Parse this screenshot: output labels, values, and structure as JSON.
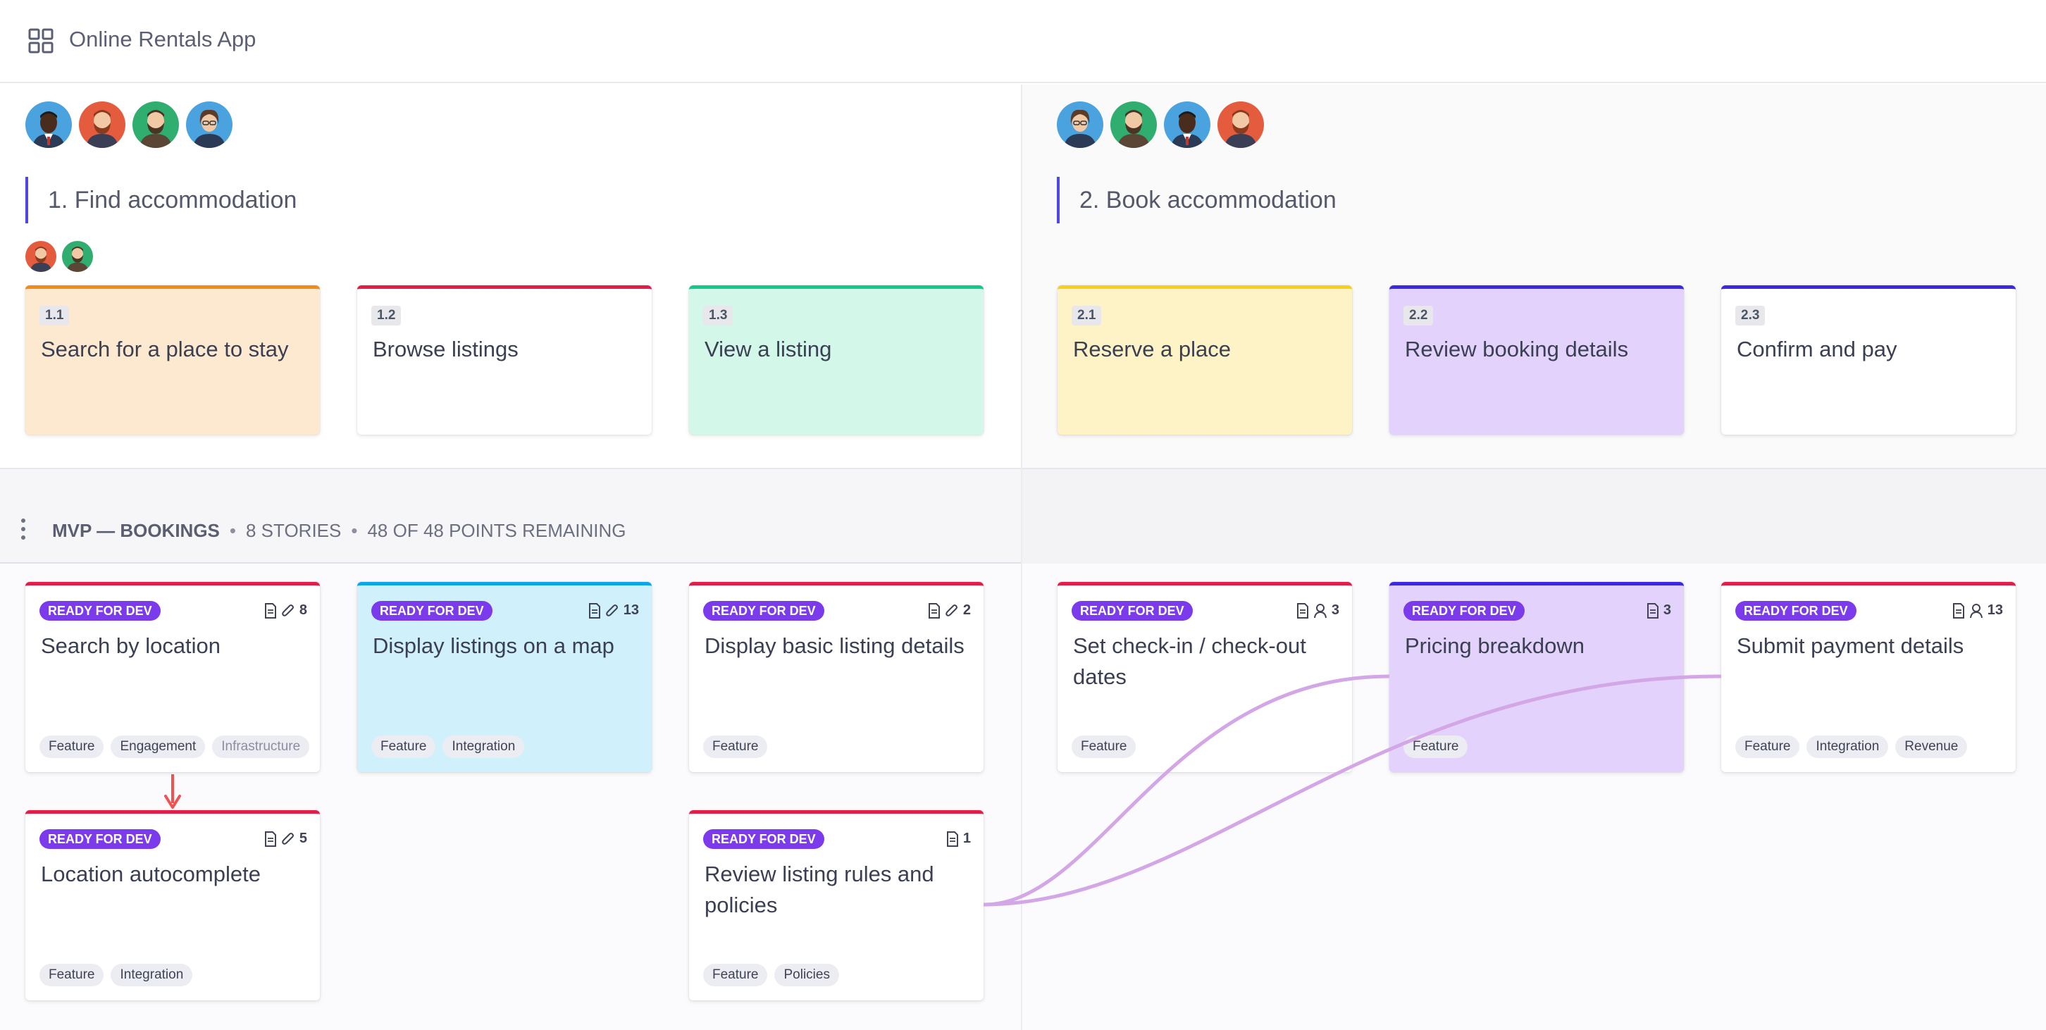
{
  "app": {
    "title": "Online Rentals App",
    "icon": "grid-icon"
  },
  "activities": [
    {
      "label": "1. Find accommodation"
    },
    {
      "label": "2. Book accommodation"
    }
  ],
  "steps": [
    {
      "num": "1.1",
      "title": "Search for a place to stay",
      "bg": "#fde8d0",
      "border": "#f08c1a"
    },
    {
      "num": "1.2",
      "title": "Browse listings",
      "bg": "#ffffff",
      "border": "#e11d48"
    },
    {
      "num": "1.3",
      "title": "View a listing",
      "bg": "#d3f7e9",
      "border": "#10c98a"
    },
    {
      "num": "2.1",
      "title": "Reserve a place",
      "bg": "#fdf3c6",
      "border": "#f5d11c"
    },
    {
      "num": "2.2",
      "title": "Review booking details",
      "bg": "#e3d3fc",
      "border": "#3b28e0"
    },
    {
      "num": "2.3",
      "title": "Confirm and pay",
      "bg": "#ffffff",
      "border": "#3b28e0"
    }
  ],
  "release": {
    "name": "MVP — BOOKINGS",
    "stories": "8 STORIES",
    "points": "48 OF 48 POINTS REMAINING"
  },
  "stories": [
    {
      "status": "READY FOR DEV",
      "title": "Search by location",
      "points": "8",
      "icons": [
        "doc-icon",
        "paperclip-icon"
      ],
      "tags": [
        "Feature",
        "Engagement",
        "Infrastructure"
      ],
      "bg": "#ffffff",
      "border": "#e11d48"
    },
    {
      "status": "READY FOR DEV",
      "title": "Display listings on a map",
      "points": "13",
      "icons": [
        "doc-icon",
        "paperclip-icon"
      ],
      "tags": [
        "Feature",
        "Integration"
      ],
      "bg": "#d0f1fb",
      "border": "#0ea5e9"
    },
    {
      "status": "READY FOR DEV",
      "title": "Display basic listing details",
      "points": "2",
      "icons": [
        "doc-icon",
        "paperclip-icon"
      ],
      "tags": [
        "Feature"
      ],
      "bg": "#ffffff",
      "border": "#e11d48"
    },
    {
      "status": "READY FOR DEV",
      "title": "Set check-in / check-out dates",
      "points": "3",
      "icons": [
        "doc-icon",
        "user-icon"
      ],
      "tags": [
        "Feature"
      ],
      "bg": "#ffffff",
      "border": "#e11d48"
    },
    {
      "status": "READY FOR DEV",
      "title": "Pricing breakdown",
      "points": "3",
      "icons": [
        "doc-icon"
      ],
      "tags": [
        "Feature"
      ],
      "bg": "#e3d3fc",
      "border": "#3b28e0"
    },
    {
      "status": "READY FOR DEV",
      "title": "Submit payment details",
      "points": "13",
      "icons": [
        "doc-icon",
        "user-icon"
      ],
      "tags": [
        "Feature",
        "Integration",
        "Revenue"
      ],
      "bg": "#ffffff",
      "border": "#e11d48"
    },
    {
      "status": "READY FOR DEV",
      "title": "Location autocomplete",
      "points": "5",
      "icons": [
        "doc-icon",
        "paperclip-icon"
      ],
      "tags": [
        "Feature",
        "Integration"
      ],
      "bg": "#ffffff",
      "border": "#e11d48"
    },
    {
      "status": "READY FOR DEV",
      "title": "Review listing rules and policies",
      "points": "1",
      "icons": [
        "doc-icon"
      ],
      "tags": [
        "Feature",
        "Policies"
      ],
      "bg": "#ffffff",
      "border": "#e11d48"
    }
  ],
  "colors": {
    "accent": "#4f46e5",
    "badge": "#7c3aed",
    "dependency": "#d3a6e6",
    "blocker_arrow": "#f05252"
  }
}
